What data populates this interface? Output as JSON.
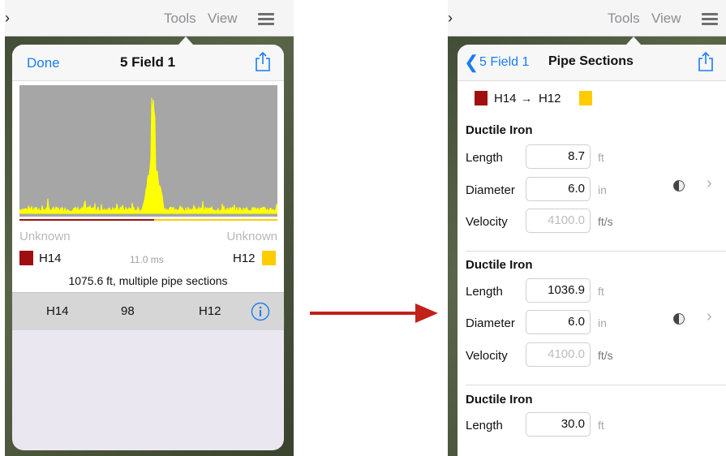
{
  "app_topbar": {
    "back_glyph": "›",
    "tools": "Tools",
    "view": "View",
    "menu_icon": "hamburger-icon"
  },
  "left": {
    "title": "5 Field 1",
    "done": "Done",
    "share_icon": "share-icon",
    "left_material": "Unknown",
    "right_material": "Unknown",
    "left_hydrant": "H14",
    "right_hydrant": "H12",
    "delay": "11.0 ms",
    "summary": "1075.6 ft, multiple pipe sections",
    "result_row": {
      "from": "H14",
      "value": "98",
      "to": "H12",
      "info_icon": "info-icon"
    },
    "colors": {
      "left_swatch": "#a00f0f",
      "right_swatch": "#ffcc00",
      "signal": "#ffff00",
      "plot_bg": "#a6a6a6"
    }
  },
  "arrow_color": "#c0211b",
  "right": {
    "back_label": "5 Field 1",
    "title": "Pipe Sections",
    "from": "H14",
    "arrow": "→",
    "to": "H12",
    "labels": {
      "length": "Length",
      "diameter": "Diameter",
      "velocity": "Velocity"
    },
    "sections": [
      {
        "material": "Ductile Iron",
        "length": "8.7",
        "length_unit": "ft",
        "diameter": "6.0",
        "diameter_unit": "in",
        "velocity": "4100.0",
        "velocity_unit": "ft/s"
      },
      {
        "material": "Ductile Iron",
        "length": "1036.9",
        "length_unit": "ft",
        "diameter": "6.0",
        "diameter_unit": "in",
        "velocity": "4100.0",
        "velocity_unit": "ft/s"
      },
      {
        "material": "Ductile Iron",
        "length": "30.0",
        "length_unit": "ft"
      }
    ]
  }
}
